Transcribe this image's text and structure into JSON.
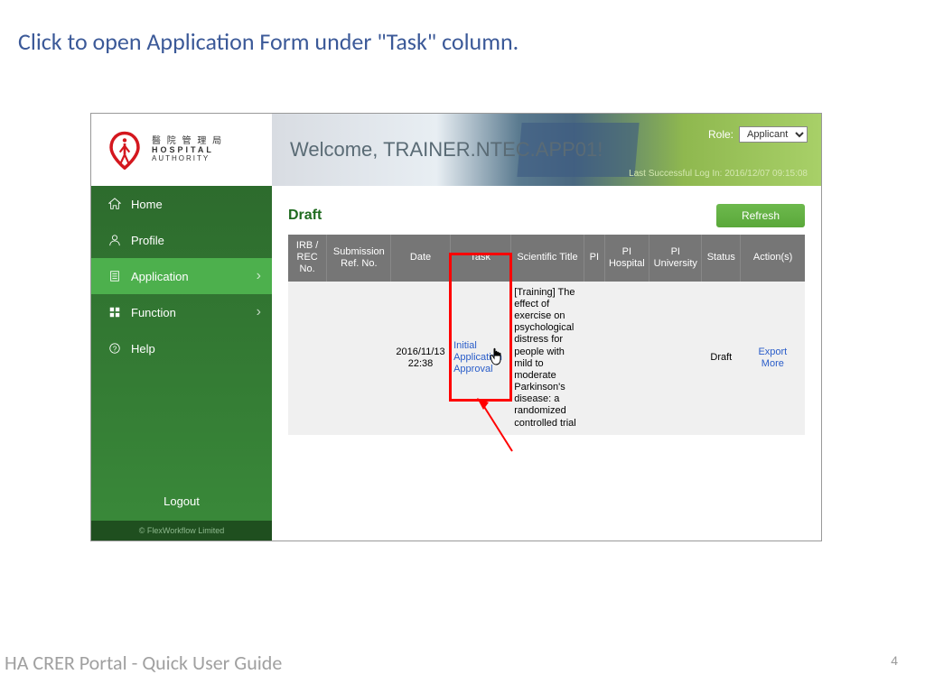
{
  "slide": {
    "instruction": "Click to open Application Form under \"Task\" column.",
    "footer": "HA CRER Portal - Quick User Guide",
    "page_number": "4"
  },
  "logo": {
    "line_cn": "醫 院 管 理 局",
    "line_en1": "HOSPITAL",
    "line_en2": "AUTHORITY"
  },
  "banner": {
    "welcome": "Welcome, TRAINER.NTEC.APP01!",
    "role_label": "Role:",
    "role_value": "Applicant",
    "last_login": "Last Successful Log In: 2016/12/07 09:15:08"
  },
  "sidebar": {
    "items": [
      {
        "label": "Home"
      },
      {
        "label": "Profile"
      },
      {
        "label": "Application"
      },
      {
        "label": "Function"
      },
      {
        "label": "Help"
      }
    ],
    "logout": "Logout",
    "copyright": "© FlexWorkflow Limited"
  },
  "main": {
    "section_title": "Draft",
    "refresh": "Refresh",
    "columns": {
      "c0": "IRB / REC No.",
      "c1": "Submission Ref. No.",
      "c2": "Date",
      "c3": "Task",
      "c4": "Scientific Title",
      "c5": "PI",
      "c6": "PI Hospital",
      "c7": "PI University",
      "c8": "Status",
      "c9": "Action(s)"
    },
    "row": {
      "date": "2016/11/13 22:38",
      "task": "Initial Application Approval",
      "sci_title": "[Training] The effect of exercise on psychological distress for people with mild to moderate Parkinson's disease: a randomized controlled trial",
      "status": "Draft",
      "action_export": "Export",
      "action_more": "More"
    }
  }
}
